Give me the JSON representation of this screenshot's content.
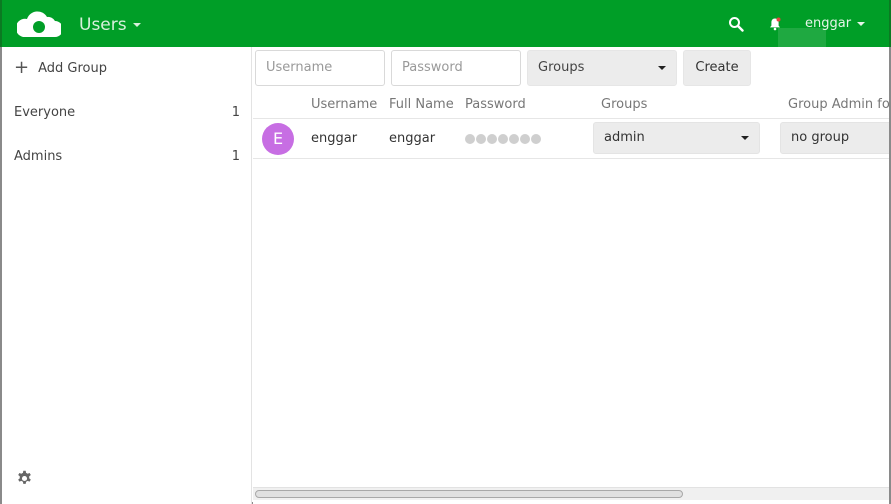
{
  "header": {
    "app_title": "Users",
    "user": "enggar",
    "icons": {
      "logo": "cloud-logo",
      "search": "search-icon",
      "notifications": "bell-icon"
    }
  },
  "colors": {
    "header_bg": "#009e27",
    "avatar_bg": "#c76ee3"
  },
  "sidebar": {
    "add_group_label": "Add Group",
    "groups": [
      {
        "name": "Everyone",
        "count": "1"
      },
      {
        "name": "Admins",
        "count": "1"
      }
    ],
    "settings_icon": "gear-icon"
  },
  "new_user": {
    "username_placeholder": "Username",
    "password_placeholder": "Password",
    "groups_select": "Groups",
    "create_label": "Create"
  },
  "table": {
    "columns": [
      "Username",
      "Full Name",
      "Password",
      "Groups",
      "Group Admin for"
    ],
    "rows": [
      {
        "avatar_letter": "E",
        "username": "enggar",
        "full_name": "enggar",
        "groups": "admin",
        "group_admin": "no group"
      }
    ]
  }
}
